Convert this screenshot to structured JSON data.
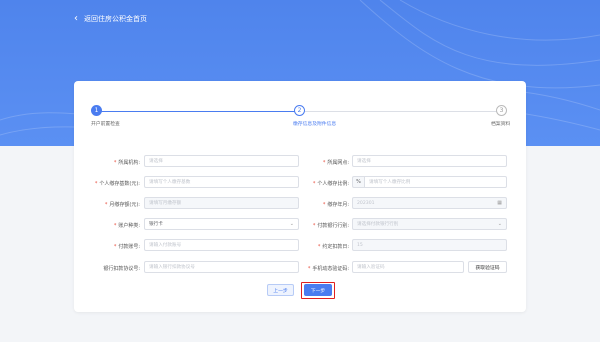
{
  "header": {
    "back_label": "返回住房公积金首页"
  },
  "steps": [
    {
      "number": "1",
      "label": "开户前置检查",
      "status": "done"
    },
    {
      "number": "2",
      "label": "缴存信息及附件信息",
      "status": "active"
    },
    {
      "number": "3",
      "label": "档案资料",
      "status": "pending"
    }
  ],
  "form": {
    "org": {
      "label": "所属机构:",
      "placeholder": "请选择"
    },
    "district": {
      "label": "所属网点:",
      "placeholder": "请选择"
    },
    "personal_base": {
      "label": "个人缴存基数(元):",
      "placeholder": "请填写个人缴存基数"
    },
    "personal_ratio": {
      "label": "个人缴存比例:",
      "prefix": "%",
      "placeholder": "请填写个人缴存比例"
    },
    "monthly_amount": {
      "label": "月缴存额(元):",
      "placeholder": "请填写月缴存额"
    },
    "pay_month": {
      "label": "缴存年月:",
      "value": "202301",
      "icon": "calendar-icon"
    },
    "account_type": {
      "label": "账户种类:",
      "value": "银行卡",
      "icon": "chevron-down-icon"
    },
    "bank": {
      "label": "付款银行行别:",
      "placeholder": "请选择付款银行行别",
      "icon": "chevron-down-icon"
    },
    "pay_account": {
      "label": "付款账号:",
      "placeholder": "请输入付款账号"
    },
    "deduct_day": {
      "label": "约定扣款日:",
      "value": "15"
    },
    "agreement_no": {
      "label": "银行扣款协议号:",
      "placeholder": "请输入银行扣款协议号"
    },
    "sms_code": {
      "label": "手机动态验证码:",
      "placeholder": "请输入验证码"
    },
    "get_code_label": "获取验证码"
  },
  "actions": {
    "prev_label": "上一步",
    "next_label": "下一步"
  },
  "colors": {
    "accent": "#4a7cf0",
    "required": "#e74c3c",
    "highlight": "#e02020"
  }
}
